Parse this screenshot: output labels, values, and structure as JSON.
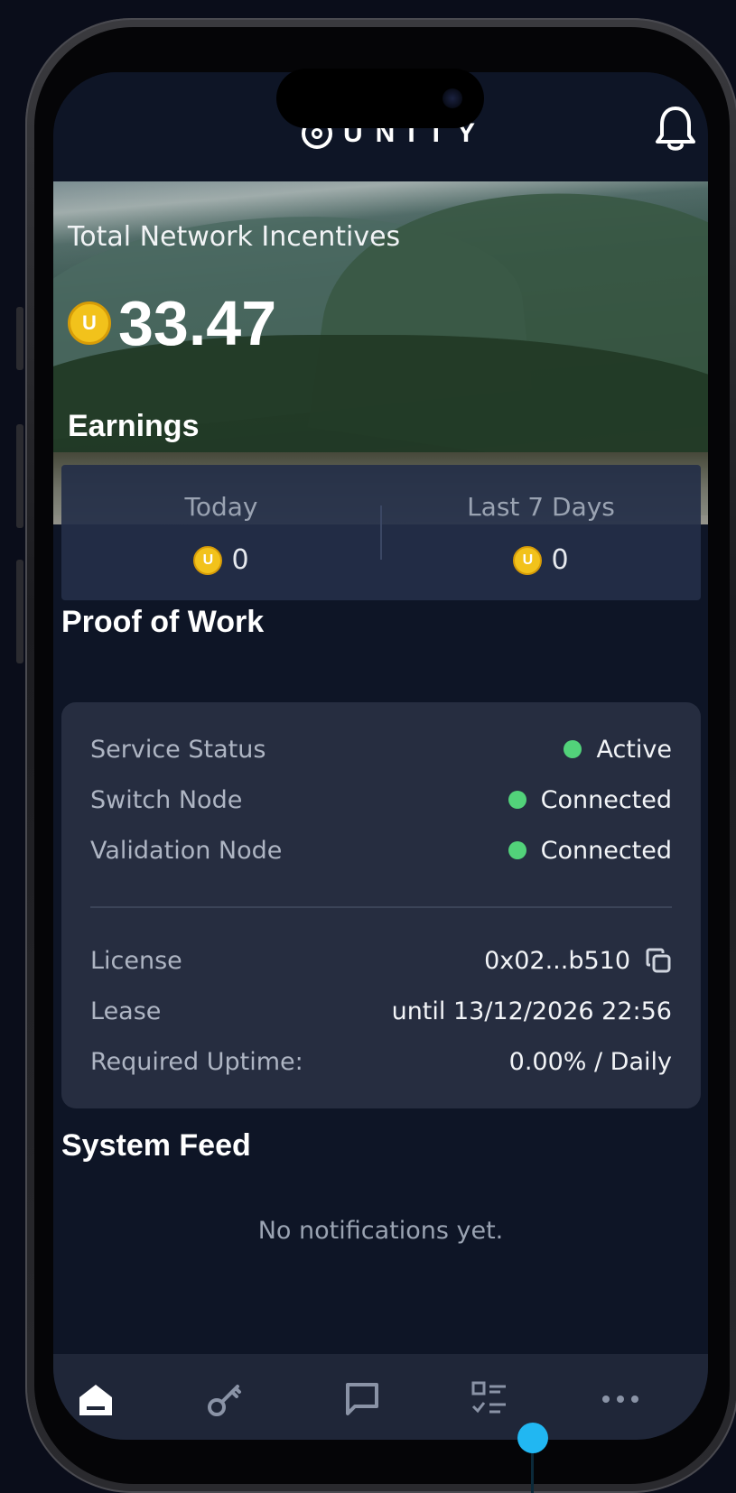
{
  "app": {
    "brand": "UNITY"
  },
  "hero": {
    "label": "Total Network Incentives",
    "coin_symbol": "U",
    "amount": "33.47"
  },
  "earnings": {
    "title": "Earnings",
    "today": {
      "label": "Today",
      "coin_symbol": "U",
      "value": "0"
    },
    "last7": {
      "label": "Last 7 Days",
      "coin_symbol": "U",
      "value": "0"
    }
  },
  "proof_of_work": {
    "title": "Proof of Work",
    "status_rows": [
      {
        "key": "Service Status",
        "value": "Active",
        "dot_color": "#52d27a"
      },
      {
        "key": "Switch Node",
        "value": "Connected",
        "dot_color": "#52d27a"
      },
      {
        "key": "Validation Node",
        "value": "Connected",
        "dot_color": "#52d27a"
      }
    ],
    "license": {
      "key": "License",
      "value": "0x02...b510"
    },
    "lease": {
      "key": "Lease",
      "value": "until 13/12/2026 22:56"
    },
    "uptime": {
      "key": "Required Uptime:",
      "value": "0.00% / Daily"
    }
  },
  "system_feed": {
    "title": "System Feed",
    "empty": "No notifications yet."
  },
  "tabbar": {
    "items": [
      {
        "icon": "home-icon",
        "active": true
      },
      {
        "icon": "key-icon",
        "active": false
      },
      {
        "icon": "chat-icon",
        "active": false
      },
      {
        "icon": "checklist-icon",
        "active": false
      },
      {
        "icon": "more-icon",
        "active": false
      }
    ]
  },
  "colors": {
    "background": "#0e1526",
    "card": "#262d40",
    "accent_coin": "#f2c21b",
    "status_green": "#52d27a",
    "indicator": "#21b7f2"
  }
}
